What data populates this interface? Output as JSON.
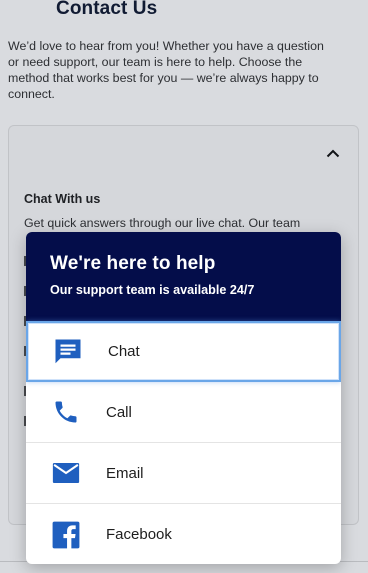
{
  "page": {
    "title": "Contact Us",
    "intro": "We’d love to hear from you! Whether you have a question or need support, our team is here to help. Choose the method that works best for you — we’re always happy to connect.",
    "card": {
      "heading": "Chat With us",
      "text": "Get quick answers through our live chat. Our team"
    }
  },
  "help_popup": {
    "title": "We're here to help",
    "subtitle": "Our support team is available 24/7",
    "options": [
      {
        "label": "Chat",
        "icon": "chat-icon",
        "active": true
      },
      {
        "label": "Call",
        "icon": "phone-icon"
      },
      {
        "label": "Email",
        "icon": "email-icon"
      },
      {
        "label": "Facebook",
        "icon": "facebook-icon"
      }
    ]
  },
  "colors": {
    "header_bg": "#040d4a",
    "icon_blue": "#1f5fbf",
    "active_border": "#6aa6e8"
  }
}
